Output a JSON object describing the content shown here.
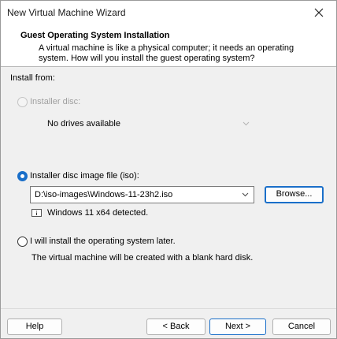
{
  "window": {
    "title": "New Virtual Machine Wizard"
  },
  "header": {
    "title": "Guest Operating System Installation",
    "description": "A virtual machine is like a physical computer; it needs an operating system. How will you install the guest operating system?"
  },
  "install_from": {
    "label": "Install from:",
    "installer_disc": {
      "label": "Installer disc:",
      "selected": false,
      "enabled": false,
      "dropdown_value": "No drives available"
    },
    "iso_image": {
      "label": "Installer disc image file (iso):",
      "selected": true,
      "path": "D:\\iso-images\\Windows-11-23h2.iso",
      "browse_label": "Browse...",
      "detected_text": "Windows 11 x64 detected."
    },
    "later": {
      "label": "I will install the operating system later.",
      "selected": false,
      "note": "The virtual machine will be created with a blank hard disk."
    }
  },
  "footer": {
    "help_label": "Help",
    "back_label": "< Back",
    "next_label": "Next >",
    "cancel_label": "Cancel"
  },
  "colors": {
    "accent": "#1a6fc9",
    "dialog_bg": "#f0f0f0",
    "disabled_text": "#a0a0a0"
  }
}
